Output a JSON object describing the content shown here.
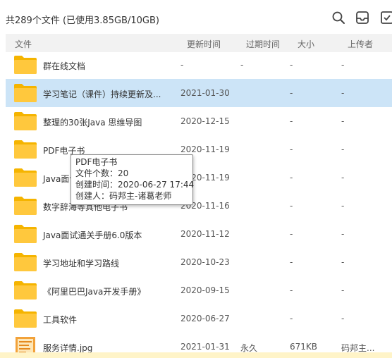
{
  "header": {
    "summary": "共289个文件 (已使用3.85GB/10GB)",
    "icons": [
      "search-icon",
      "inbox-icon",
      "check-icon"
    ]
  },
  "columns": {
    "file": "文件",
    "modified": "更新时间",
    "expires": "过期时间",
    "size": "大小",
    "uploader": "上传者"
  },
  "rows": [
    {
      "name": "群在线文档",
      "modified": "-",
      "expires": "-",
      "size": "-",
      "uploader": "-",
      "type": "folder"
    },
    {
      "name": "学习笔记（课件）持续更新及...",
      "modified": "2021-01-30",
      "expires": "",
      "size": "-",
      "uploader": "-",
      "type": "folder",
      "selected": true
    },
    {
      "name": "整理的30张Java 思维导图",
      "modified": "2020-12-15",
      "expires": "",
      "size": "-",
      "uploader": "-",
      "type": "folder"
    },
    {
      "name": "PDF电子书",
      "modified": "2020-11-19",
      "expires": "",
      "size": "-",
      "uploader": "-",
      "type": "folder"
    },
    {
      "name": "Java面试",
      "modified": "2020-11-19",
      "expires": "",
      "size": "-",
      "uploader": "-",
      "type": "folder"
    },
    {
      "name": "数字辞海等其他电子书",
      "modified": "2020-11-16",
      "expires": "",
      "size": "-",
      "uploader": "-",
      "type": "folder"
    },
    {
      "name": "Java面试通关手册6.0版本",
      "modified": "2020-11-12",
      "expires": "",
      "size": "-",
      "uploader": "-",
      "type": "folder"
    },
    {
      "name": "学习地址和学习路线",
      "modified": "2020-10-23",
      "expires": "",
      "size": "-",
      "uploader": "-",
      "type": "folder"
    },
    {
      "name": "《阿里巴巴Java开发手册》",
      "modified": "2020-09-15",
      "expires": "",
      "size": "-",
      "uploader": "-",
      "type": "folder"
    },
    {
      "name": "工具软件",
      "modified": "2020-06-27",
      "expires": "",
      "size": "-",
      "uploader": "-",
      "type": "folder"
    },
    {
      "name": "服务详情.jpg",
      "modified": "2021-01-31",
      "expires": "永久",
      "size": "671KB",
      "uploader": "码邦主...",
      "type": "image"
    }
  ],
  "tooltip": {
    "title": "PDF电子书",
    "count": "文件个数：20",
    "created": "创建时间：2020-06-27 17:44",
    "creator": "创建人：码邦主-诸葛老师"
  },
  "colors": {
    "folder": "#ffc83d",
    "folder_back": "#f5b400",
    "selected_row": "#cce4f7",
    "header_bg": "#f2f2f2"
  }
}
